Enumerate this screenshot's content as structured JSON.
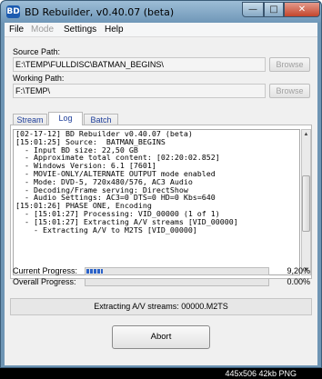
{
  "window": {
    "title": "BD Rebuilder, v0.40.07 (beta)",
    "icon_text": "BD",
    "minimize_glyph": "—",
    "maximize_glyph": "□",
    "close_glyph": "✕"
  },
  "menu": [
    "File",
    "Mode",
    "Settings",
    "Help"
  ],
  "source": {
    "label": "Source Path:",
    "value": "E:\\TEMP\\FULLDISC\\BATMAN_BEGINS\\",
    "browse": "Browse"
  },
  "working": {
    "label": "Working Path:",
    "value": "F:\\TEMP\\",
    "browse": "Browse"
  },
  "tabs": [
    "Stream",
    "Log",
    "Batch"
  ],
  "active_tab": "Log",
  "log_lines": [
    "[02-17-12] BD Rebuilder v0.40.07 (beta)",
    "[15:01:25] Source:  BATMAN_BEGINS",
    "  - Input BD size: 22,50 GB",
    "  - Approximate total content: [02:20:02.852]",
    "  - Windows Version: 6.1 [7601]",
    "  - MOVIE-ONLY/ALTERNATE OUTPUT mode enabled",
    "  - Mode: DVD-5, 720x480/576, AC3 Audio",
    "  - Decoding/Frame serving: DirectShow",
    "  - Audio Settings: AC3=0 DTS=0 HD=0 Kbs=640",
    "[15:01:26] PHASE ONE, Encoding",
    "  - [15:01:27] Processing: VID_00000 (1 of 1)",
    "  - [15:01:27] Extracting A/V streams [VID_00000]",
    "    - Extracting A/V to M2TS [VID_00000]"
  ],
  "progress": {
    "current_label": "Current Progress:",
    "current_value": "9,20%",
    "current_fraction": 0.092,
    "overall_label": "Overall Progress:",
    "overall_value": "0.00%",
    "overall_fraction": 0
  },
  "status": "Extracting A/V streams: 00000.M2TS",
  "abort_label": "Abort",
  "caption": "445x506  42kb  PNG",
  "colors": {
    "progress_fill": "#2b62c9",
    "tab_text": "#1f3f9a",
    "title_bar": "#6f97b8"
  }
}
